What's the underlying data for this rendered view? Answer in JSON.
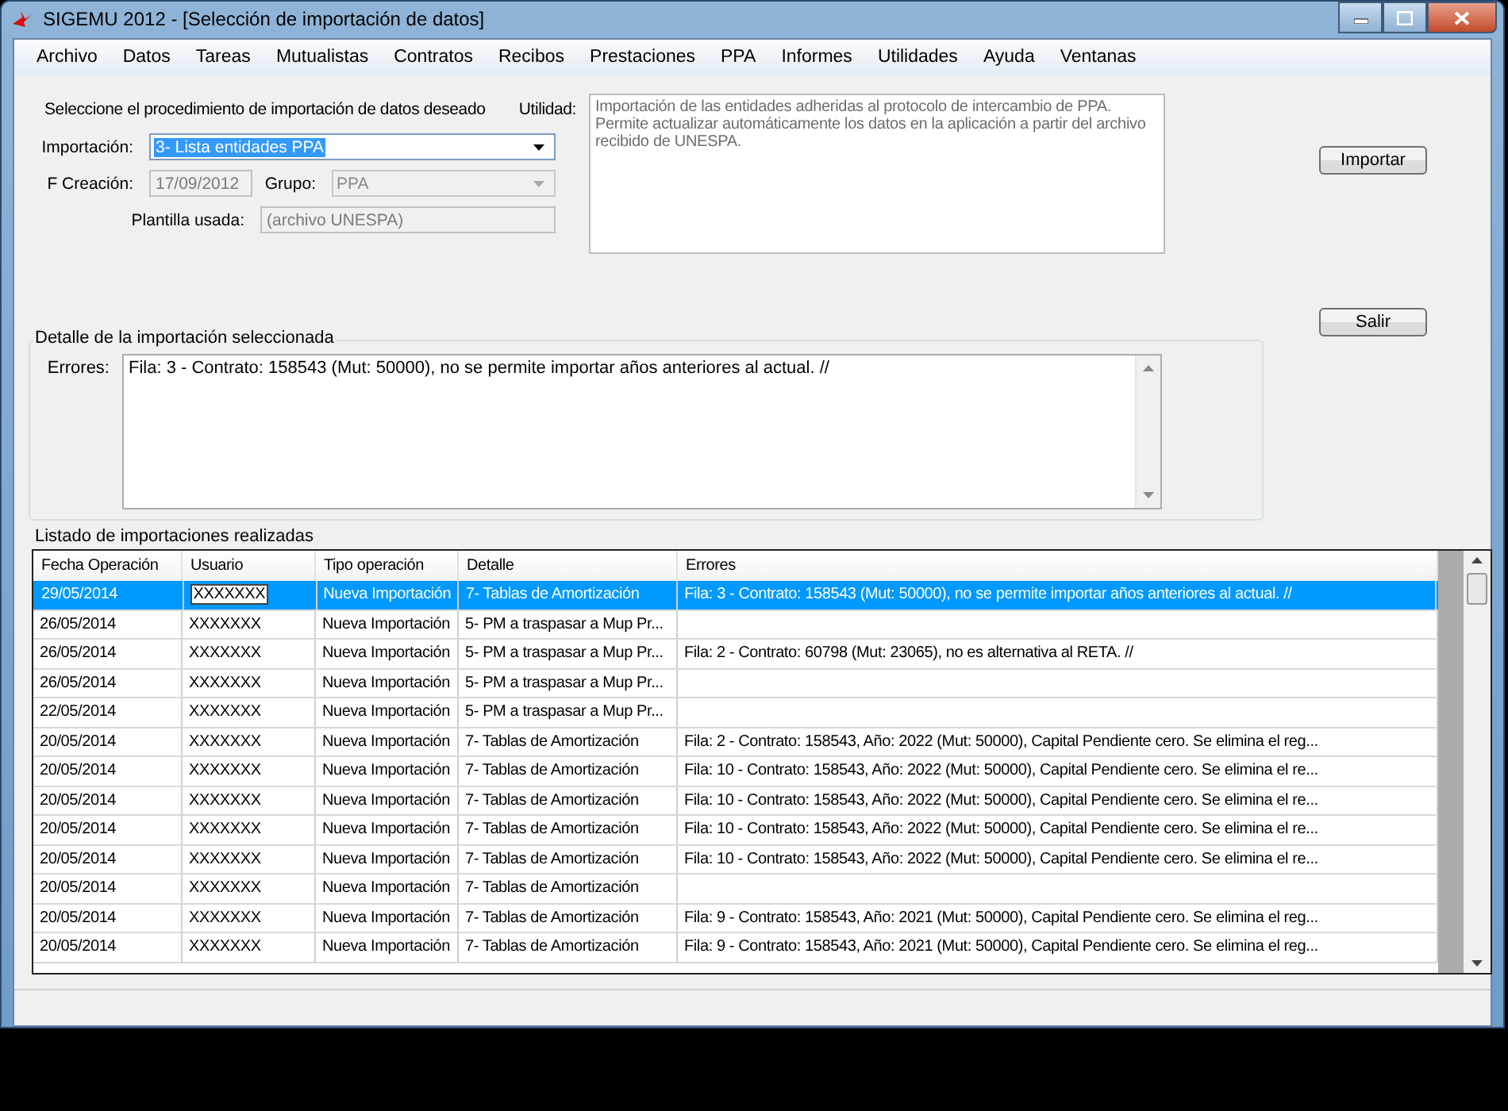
{
  "window": {
    "title": "SIGEMU 2012 - [Selección de importación de datos]"
  },
  "menu": [
    "Archivo",
    "Datos",
    "Tareas",
    "Mutualistas",
    "Contratos",
    "Recibos",
    "Prestaciones",
    "PPA",
    "Informes",
    "Utilidades",
    "Ayuda",
    "Ventanas"
  ],
  "form": {
    "instruction": "Seleccione el procedimiento de importación de datos deseado",
    "importacion": {
      "label": "Importación:",
      "value": "3- Lista entidades PPA"
    },
    "f_creacion": {
      "label": "F Creación:",
      "value": "17/09/2012"
    },
    "grupo": {
      "label": "Grupo:",
      "value": "PPA",
      "disabled": true
    },
    "plantilla": {
      "label": "Plantilla usada:",
      "value": "(archivo UNESPA)"
    },
    "utilidad": {
      "label": "Utilidad:",
      "lines": [
        "Importación de las entidades adheridas al protocolo de intercambio de PPA.",
        "Permite actualizar automáticamente los datos en la aplicación a partir del archivo",
        "recibido de UNESPA."
      ]
    }
  },
  "buttons": [
    "Importar",
    "Salir"
  ],
  "detail": {
    "title": "Detalle de la importación seleccionada",
    "label": "Errores:",
    "text": "Fila: 3 - Contrato: 158543 (Mut: 50000), no se permite importar años anteriores al actual. //"
  },
  "list": {
    "title": "Listado de importaciones realizadas",
    "columns": [
      "Fecha Operación",
      "Usuario",
      "Tipo operación",
      "Detalle",
      "Errores"
    ],
    "rows": [
      {
        "selected": true,
        "cells": [
          "29/05/2014",
          "XXXXXXX",
          "Nueva Importación",
          "7- Tablas de Amortización",
          "Fila: 3 - Contrato: 158543 (Mut: 50000), no se permite importar años anteriores al actual. //"
        ]
      },
      {
        "selected": false,
        "cells": [
          "26/05/2014",
          "XXXXXXX",
          "Nueva Importación",
          "5- PM a traspasar a Mup Pr...",
          ""
        ]
      },
      {
        "selected": false,
        "cells": [
          "26/05/2014",
          "XXXXXXX",
          "Nueva Importación",
          "5- PM a traspasar a Mup Pr...",
          "Fila: 2 - Contrato: 60798 (Mut: 23065), no es alternativa al RETA. //"
        ]
      },
      {
        "selected": false,
        "cells": [
          "26/05/2014",
          "XXXXXXX",
          "Nueva Importación",
          "5- PM a traspasar a Mup Pr...",
          ""
        ]
      },
      {
        "selected": false,
        "cells": [
          "22/05/2014",
          "XXXXXXX",
          "Nueva Importación",
          "5- PM a traspasar a Mup Pr...",
          ""
        ]
      },
      {
        "selected": false,
        "cells": [
          "20/05/2014",
          "XXXXXXX",
          "Nueva Importación",
          "7- Tablas de Amortización",
          "Fila: 2 - Contrato: 158543, Año: 2022 (Mut: 50000), Capital Pendiente cero. Se elimina el reg..."
        ]
      },
      {
        "selected": false,
        "cells": [
          "20/05/2014",
          "XXXXXXX",
          "Nueva Importación",
          "7- Tablas de Amortización",
          "Fila: 10 - Contrato: 158543, Año: 2022 (Mut: 50000), Capital Pendiente cero. Se elimina el re..."
        ]
      },
      {
        "selected": false,
        "cells": [
          "20/05/2014",
          "XXXXXXX",
          "Nueva Importación",
          "7- Tablas de Amortización",
          "Fila: 10 - Contrato: 158543, Año: 2022 (Mut: 50000), Capital Pendiente cero. Se elimina el re..."
        ]
      },
      {
        "selected": false,
        "cells": [
          "20/05/2014",
          "XXXXXXX",
          "Nueva Importación",
          "7- Tablas de Amortización",
          "Fila: 10 - Contrato: 158543, Año: 2022 (Mut: 50000), Capital Pendiente cero. Se elimina el re..."
        ]
      },
      {
        "selected": false,
        "cells": [
          "20/05/2014",
          "XXXXXXX",
          "Nueva Importación",
          "7- Tablas de Amortización",
          "Fila: 10 - Contrato: 158543, Año: 2022 (Mut: 50000), Capital Pendiente cero. Se elimina el re..."
        ]
      },
      {
        "selected": false,
        "cells": [
          "20/05/2014",
          "XXXXXXX",
          "Nueva Importación",
          "7- Tablas de Amortización",
          ""
        ]
      },
      {
        "selected": false,
        "cells": [
          "20/05/2014",
          "XXXXXXX",
          "Nueva Importación",
          "7- Tablas de Amortización",
          "Fila: 9 - Contrato: 158543, Año: 2021 (Mut: 50000), Capital Pendiente cero. Se elimina el reg..."
        ]
      },
      {
        "selected": false,
        "cells": [
          "20/05/2014",
          "XXXXXXX",
          "Nueva Importación",
          "7- Tablas de Amortización",
          "Fila: 9 - Contrato: 158543, Año: 2021 (Mut: 50000), Capital Pendiente cero. Se elimina el reg..."
        ]
      }
    ]
  }
}
